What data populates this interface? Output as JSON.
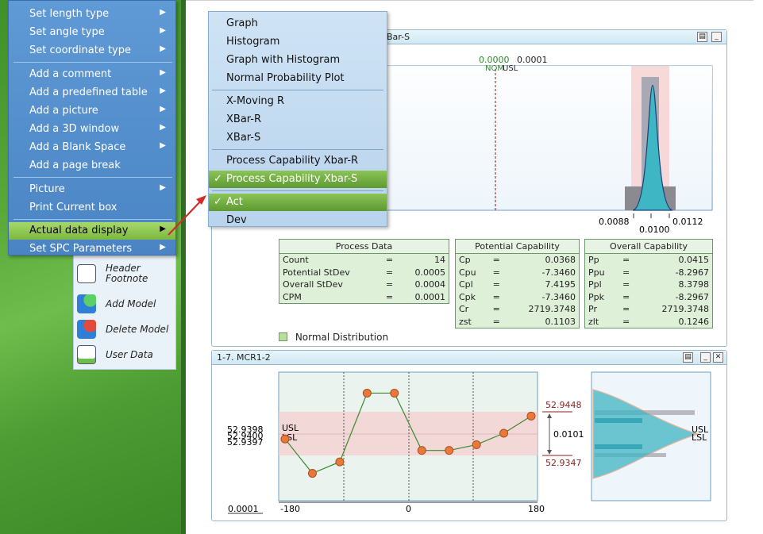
{
  "menu": {
    "items": [
      {
        "label": "Set length type",
        "submenu": true
      },
      {
        "label": "Set angle type",
        "submenu": true
      },
      {
        "label": "Set coordinate type",
        "submenu": true
      },
      {
        "label": "Add a comment",
        "submenu": true
      },
      {
        "label": "Add a predefined table",
        "submenu": true
      },
      {
        "label": "Add a picture",
        "submenu": true
      },
      {
        "label": "Add a 3D window",
        "submenu": true
      },
      {
        "label": "Add a Blank Space",
        "submenu": true
      },
      {
        "label": "Add a page break",
        "submenu": false
      },
      {
        "label": "Picture",
        "submenu": true
      },
      {
        "label": "Print Current box",
        "submenu": false
      },
      {
        "label": "Actual data display",
        "submenu": true,
        "active": true
      },
      {
        "label": "Set SPC Parameters",
        "submenu": true
      }
    ]
  },
  "submenu": {
    "items": [
      {
        "label": "Graph"
      },
      {
        "label": "Histogram"
      },
      {
        "label": "Graph with Histogram"
      },
      {
        "label": "Normal Probability Plot"
      },
      {
        "label": "X-Moving R"
      },
      {
        "label": "XBar-R"
      },
      {
        "label": "XBar-S"
      },
      {
        "label": "Process Capability Xbar-R"
      },
      {
        "label": "Process Capability Xbar-S",
        "checked": true
      },
      {
        "label": "Act",
        "checked": true
      },
      {
        "label": "Dev"
      }
    ]
  },
  "tools": [
    {
      "label": "Header Footnote",
      "icon": "header-footnote-icon"
    },
    {
      "label": "Add Model",
      "icon": "add-model-icon"
    },
    {
      "label": "Delete Model",
      "icon": "delete-model-icon"
    },
    {
      "label": "User Data",
      "icon": "user-data-icon"
    }
  ],
  "top_panel": {
    "title_fragment": "Bar-S",
    "nom_value": "0.0000",
    "usl_value": "0.0001",
    "nom_label": "NOM",
    "usl_label": "USL",
    "x_ticks": [
      "0.0088",
      "0.0100",
      "0.0112"
    ],
    "legend": "Normal Distribution"
  },
  "process_data": {
    "title": "Process Data",
    "rows": [
      {
        "label": "Count",
        "eq": "=",
        "value": "14"
      },
      {
        "label": "Potential StDev",
        "eq": "=",
        "value": "0.0005"
      },
      {
        "label": "Overall StDev",
        "eq": "=",
        "value": "0.0004"
      },
      {
        "label": "CPM",
        "eq": "=",
        "value": "0.0001"
      }
    ]
  },
  "potential_capability": {
    "title": "Potential Capability",
    "rows": [
      {
        "label": "Cp",
        "eq": "=",
        "value": "0.0368"
      },
      {
        "label": "Cpu",
        "eq": "=",
        "value": "-7.3460"
      },
      {
        "label": "Cpl",
        "eq": "=",
        "value": "7.4195"
      },
      {
        "label": "Cpk",
        "eq": "=",
        "value": "-7.3460"
      },
      {
        "label": "Cr",
        "eq": "=",
        "value": "2719.3748"
      },
      {
        "label": "zst",
        "eq": "=",
        "value": "0.1103"
      }
    ]
  },
  "overall_capability": {
    "title": "Overall Capability",
    "rows": [
      {
        "label": "Pp",
        "eq": "=",
        "value": "0.0415"
      },
      {
        "label": "Ppu",
        "eq": "=",
        "value": "-8.2967"
      },
      {
        "label": "Ppl",
        "eq": "=",
        "value": "8.3798"
      },
      {
        "label": "Ppk",
        "eq": "=",
        "value": "-8.2967"
      },
      {
        "label": "Pr",
        "eq": "=",
        "value": "2719.3748"
      },
      {
        "label": "zlt",
        "eq": "=",
        "value": "0.1246"
      }
    ]
  },
  "bottom_panel": {
    "title": "1-7. MCR1-2",
    "y_labels": [
      "52.9398",
      "52.9400",
      "52.9397"
    ],
    "usl_label": "USL",
    "lsl_label": "LSL",
    "scale_label": "0.0001",
    "x_ticks": [
      "-180",
      "0",
      "180"
    ],
    "upper_value": "52.9448",
    "lower_value": "52.9347",
    "range_value": "0.0101"
  },
  "chart_data": {
    "type": "line",
    "x": [
      -180,
      -150,
      -120,
      -90,
      -60,
      -30,
      0,
      30,
      60,
      90,
      120,
      150
    ],
    "xlim": [
      -180,
      180
    ],
    "series": [
      {
        "values": [
          52.9399,
          52.9396,
          52.9397,
          52.9403,
          52.9403,
          52.9398,
          52.9398,
          52.93985,
          52.93995,
          52.9401
        ]
      }
    ]
  },
  "colors": {
    "accent_green": "#7cb83f",
    "point_orange": "#e8793a",
    "tolerance_band": "#f6cfd0",
    "histogram_teal": "#3fb6c4"
  }
}
